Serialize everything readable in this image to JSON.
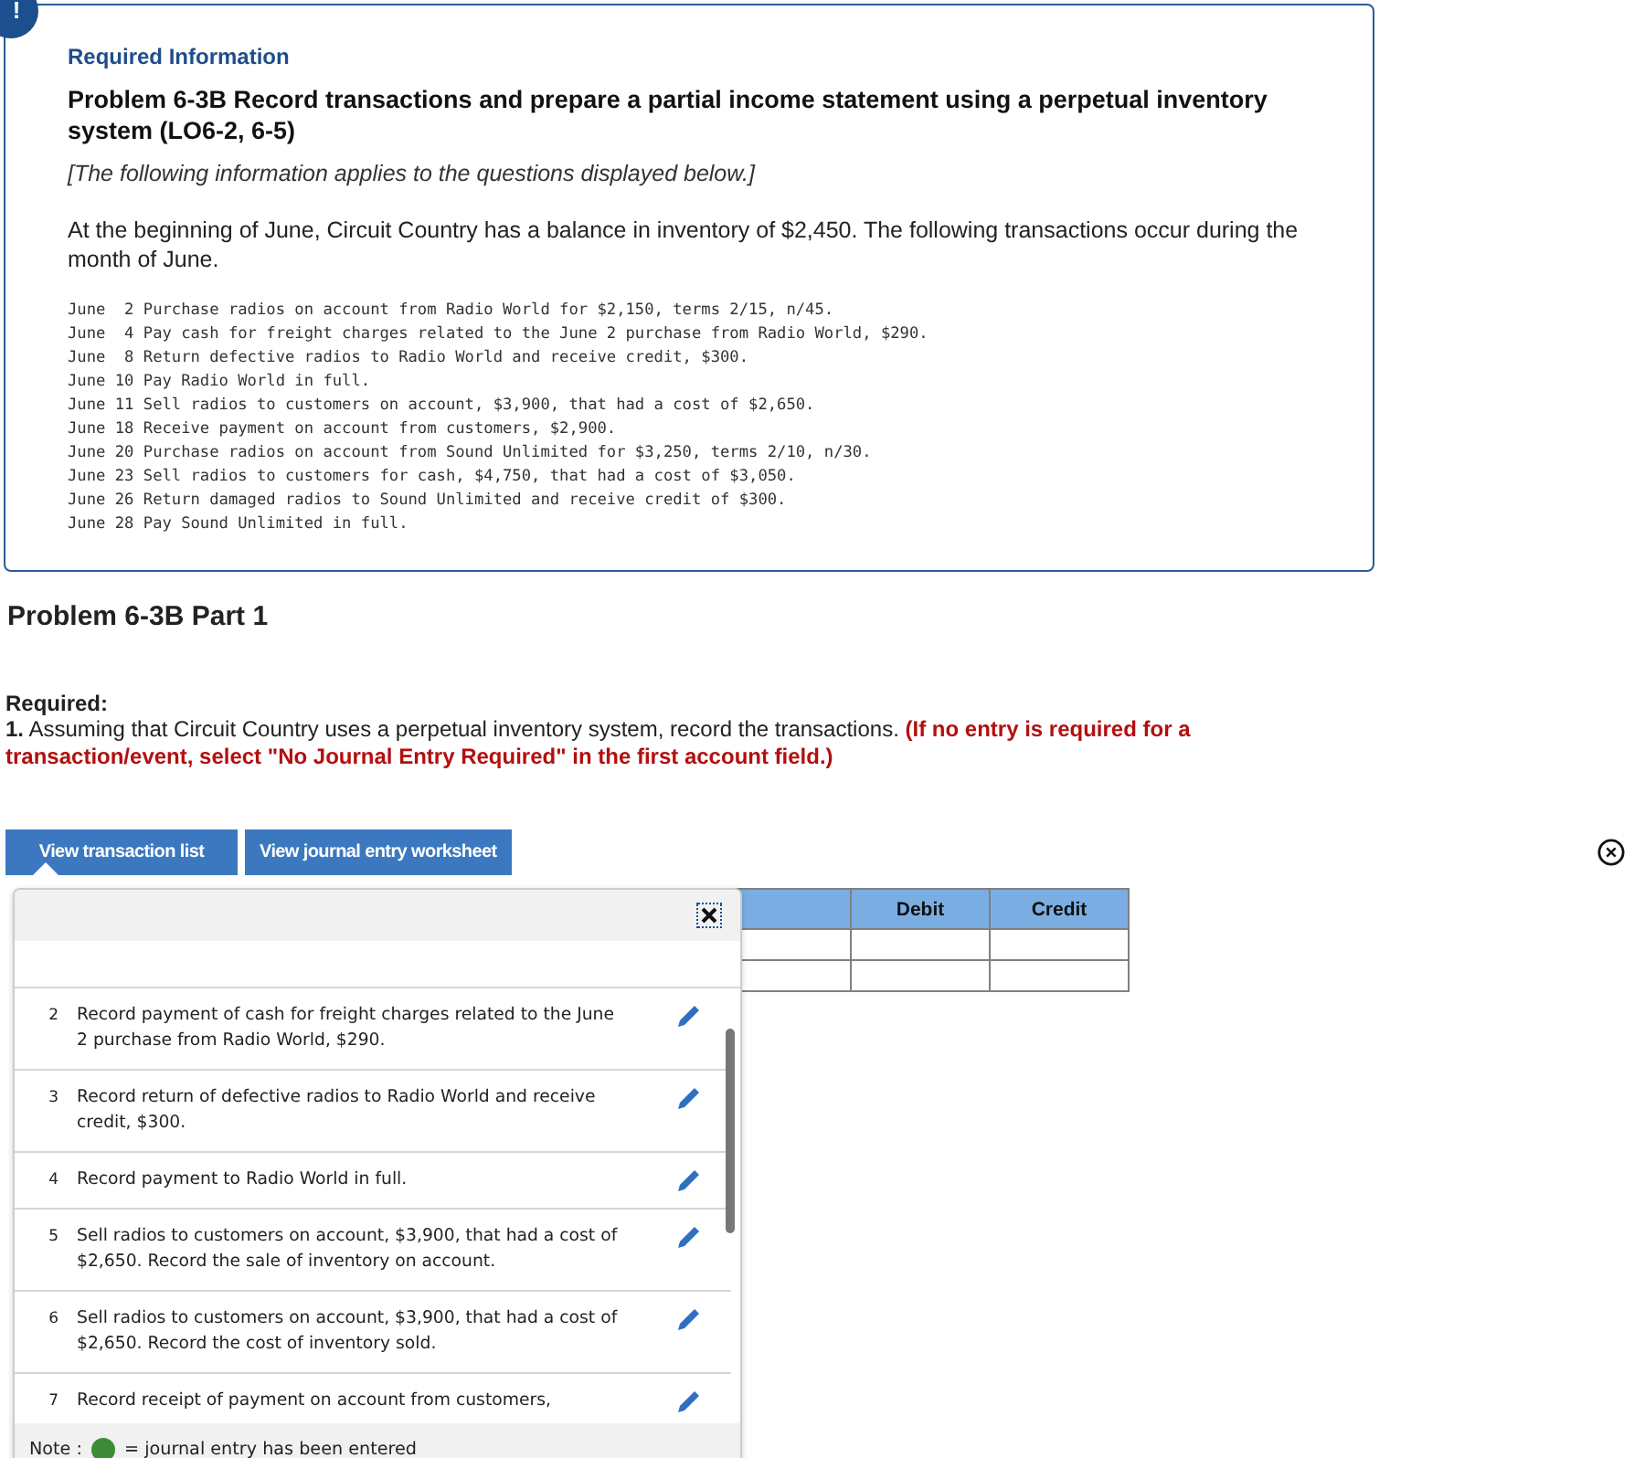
{
  "alert_badge": "!",
  "info": {
    "heading": "Required Information",
    "title": "Problem 6-3B Record transactions and prepare a partial income statement using a perpetual inventory system (LO6-2, 6-5)",
    "note": "[The following information applies to the questions displayed below.]",
    "intro": "At the beginning of June, Circuit Country has a balance in inventory of $2,450. The following transactions occur during the month of June.",
    "transactions": [
      "June  2 Purchase radios on account from Radio World for $2,150, terms 2/15, n/45.",
      "June  4 Pay cash for freight charges related to the June 2 purchase from Radio World, $290.",
      "June  8 Return defective radios to Radio World and receive credit, $300.",
      "June 10 Pay Radio World in full.",
      "June 11 Sell radios to customers on account, $3,900, that had a cost of $2,650.",
      "June 18 Receive payment on account from customers, $2,900.",
      "June 20 Purchase radios on account from Sound Unlimited for $3,250, terms 2/10, n/30.",
      "June 23 Sell radios to customers for cash, $4,750, that had a cost of $3,050.",
      "June 26 Return damaged radios to Sound Unlimited and receive credit of $300.",
      "June 28 Pay Sound Unlimited in full."
    ]
  },
  "part_title": "Problem 6-3B Part 1",
  "required": {
    "label": "Required:",
    "question": "**1.** Assuming that Circuit Country uses a perpetual inventory system, record the transactions. **(If no entry is required for a transaction/event, select \"No Journal Entry Required\" in the first account field.)**"
  },
  "tabs": [
    {
      "label": "View transaction list",
      "selected": true
    },
    {
      "label": "View journal entry worksheet",
      "selected": false
    }
  ],
  "transaction_list": {
    "items": [
      {
        "number": "2",
        "text": "Record payment of cash for freight charges related to the June 2 purchase from Radio World, $290."
      },
      {
        "number": "3",
        "text": "Record return of defective radios to Radio World and receive credit, $300."
      },
      {
        "number": "4",
        "text": "Record payment to Radio World in full."
      },
      {
        "number": "5",
        "text": "Sell radios to customers on account, $3,900, that had a cost of $2,650. Record the sale of inventory on account."
      },
      {
        "number": "6",
        "text": "Sell radios to customers on account, $3,900, that had a cost of $2,650. Record the cost of inventory sold."
      },
      {
        "number": "7",
        "text": "Record receipt of payment on account from customers,"
      }
    ],
    "note_label": "Note :",
    "note_text": "= journal entry has been entered"
  },
  "journal": {
    "columns": [
      "Debit",
      "Credit"
    ]
  }
}
